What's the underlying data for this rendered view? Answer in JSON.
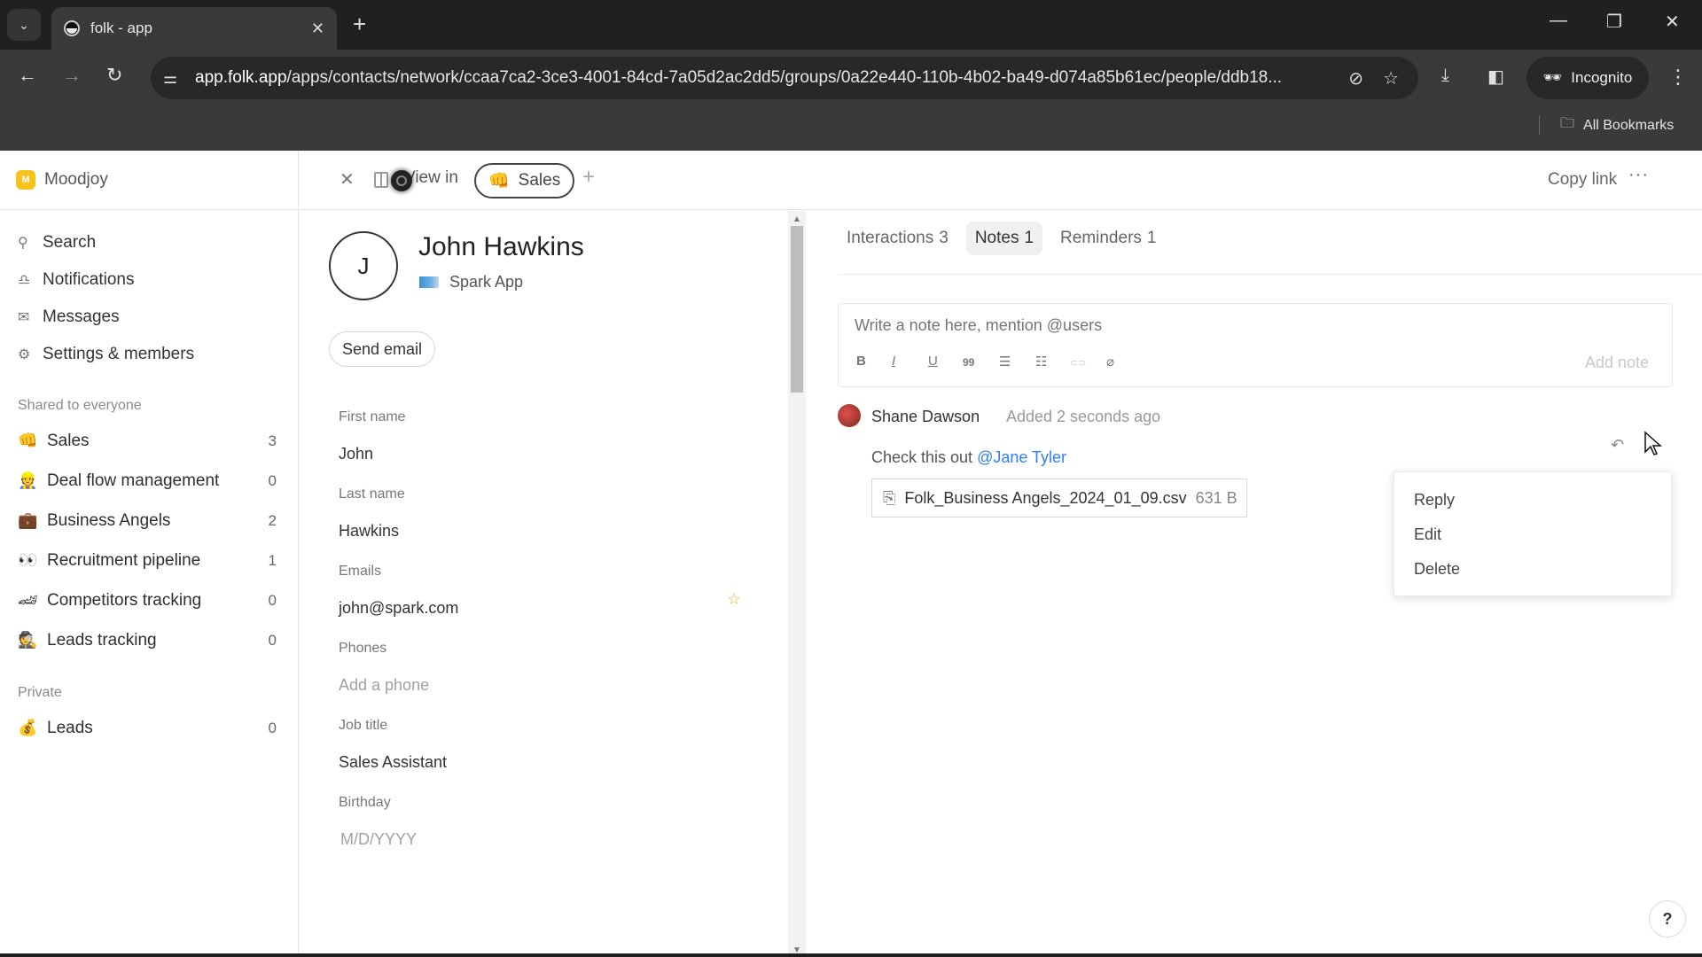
{
  "browser": {
    "tab_title": "folk - app",
    "url_host": "app.folk.app",
    "url_path": "/apps/contacts/network/ccaa7ca2-3ce3-4001-84cd-7a05d2ac2dd5/groups/0a22e440-110b-4b02-ba49-d074a85b61ec/people/ddb18...",
    "incognito_label": "Incognito",
    "all_bookmarks_label": "All Bookmarks"
  },
  "workspace": {
    "logo_letter": "M",
    "name": "Moodjoy",
    "brand_color": "#f7c21a"
  },
  "sidebar": {
    "nav": [
      {
        "icon": "search-icon",
        "glyph": "⚲",
        "label": "Search"
      },
      {
        "icon": "bell-icon",
        "glyph": "🔔",
        "label": "Notifications"
      },
      {
        "icon": "mail-icon",
        "glyph": "✉",
        "label": "Messages"
      },
      {
        "icon": "gear-icon",
        "glyph": "⚙",
        "label": "Settings & members"
      }
    ],
    "shared_label": "Shared to everyone",
    "shared_groups": [
      {
        "emoji": "👊",
        "name": "Sales",
        "count": "3"
      },
      {
        "emoji": "👷",
        "name": "Deal flow management",
        "count": "0"
      },
      {
        "emoji": "💼",
        "name": "Business Angels",
        "count": "2"
      },
      {
        "emoji": "👀",
        "name": "Recruitment pipeline",
        "count": "1"
      },
      {
        "emoji": "🏎",
        "name": "Competitors tracking",
        "count": "0"
      },
      {
        "emoji": "🕵",
        "name": "Leads tracking",
        "count": "0"
      }
    ],
    "private_label": "Private",
    "private_groups": [
      {
        "emoji": "💰",
        "name": "Leads",
        "count": "0"
      }
    ]
  },
  "detail_bar": {
    "view_in_label": "View in",
    "group_chip": {
      "emoji": "👊",
      "label": "Sales"
    },
    "copy_link_label": "Copy link",
    "more_label": "···"
  },
  "contact": {
    "initial": "J",
    "full_name": "John Hawkins",
    "company": "Spark App",
    "send_email_label": "Send email",
    "fields": {
      "first_name": {
        "label": "First name",
        "value": "John"
      },
      "last_name": {
        "label": "Last name",
        "value": "Hawkins"
      },
      "emails": {
        "label": "Emails",
        "value": "john@spark.com"
      },
      "phones": {
        "label": "Phones",
        "placeholder": "Add a phone"
      },
      "job_title": {
        "label": "Job title",
        "value": "Sales Assistant"
      },
      "birthday": {
        "label": "Birthday",
        "placeholder": "M/D/YYYY"
      }
    },
    "star_color": "#e0c020"
  },
  "tabs": [
    {
      "label": "Interactions",
      "count": "3",
      "active": false
    },
    {
      "label": "Notes",
      "count": "1",
      "active": true
    },
    {
      "label": "Reminders",
      "count": "1",
      "active": false
    }
  ],
  "composer": {
    "placeholder": "Write a note here, mention @users",
    "format_buttons": [
      {
        "name": "bold-icon",
        "glyph": "B"
      },
      {
        "name": "italic-icon",
        "glyph": "I"
      },
      {
        "name": "underline-icon",
        "glyph": "U"
      },
      {
        "name": "quote-icon",
        "glyph": "99"
      },
      {
        "name": "bullet-list-icon",
        "glyph": "☰"
      },
      {
        "name": "numbered-list-icon",
        "glyph": "☷"
      },
      {
        "name": "link-icon",
        "glyph": "⊂⊃"
      },
      {
        "name": "attachment-icon",
        "glyph": "📎"
      }
    ],
    "submit_label": "Add note"
  },
  "note": {
    "author": "Shane Dawson",
    "timestamp": "Added 2 seconds ago",
    "body": "Check this out ",
    "mention": "@Jane Tyler",
    "attachment": {
      "filename": "Folk_Business Angels_2024_01_09.csv",
      "size": "631 B"
    },
    "mention_color": "#2f80ed"
  },
  "context_menu": {
    "items": [
      "Reply",
      "Edit",
      "Delete"
    ]
  },
  "help_label": "?"
}
